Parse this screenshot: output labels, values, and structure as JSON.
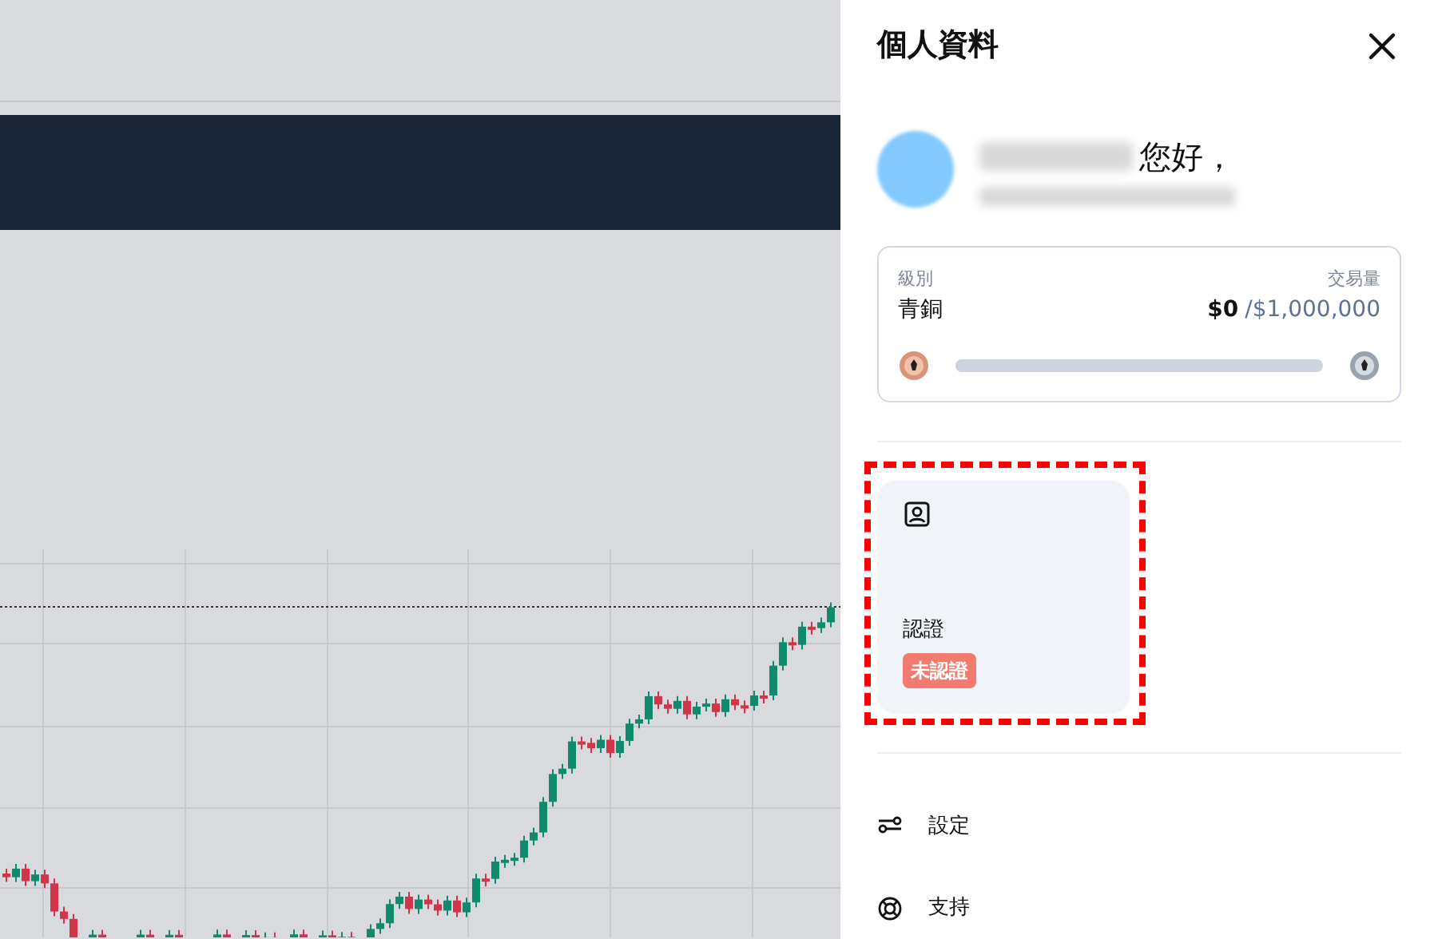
{
  "panel": {
    "title": "個人資料"
  },
  "profile": {
    "greeting": "您好，"
  },
  "tier": {
    "label": "級別",
    "value": "青銅",
    "volume_label": "交易量",
    "volume": "$0",
    "target": "/$1,000,000",
    "level": 0
  },
  "verification": {
    "title": "認證",
    "status": "未認證",
    "verified": false,
    "highlighted": true
  },
  "menu": [
    {
      "kind": "settings",
      "label": "設定"
    },
    {
      "kind": "support",
      "label": "支持"
    }
  ]
}
